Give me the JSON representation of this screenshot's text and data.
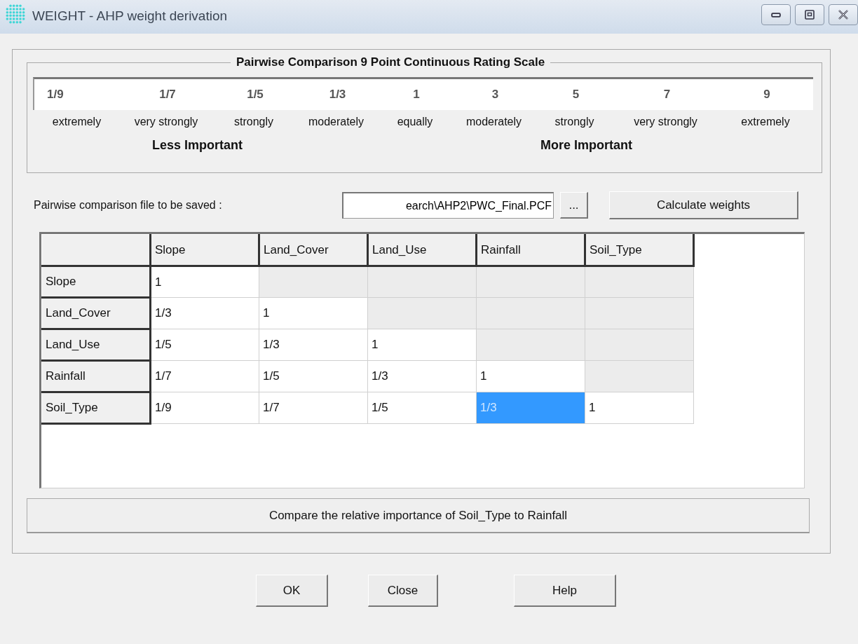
{
  "window": {
    "title": "WEIGHT - AHP weight derivation",
    "controls": [
      {
        "kind": "minimize"
      },
      {
        "kind": "maximize"
      },
      {
        "kind": "close"
      }
    ]
  },
  "scale": {
    "title": "Pairwise Comparison 9 Point Continuous Rating Scale",
    "points": [
      {
        "value": "1/9",
        "label": "extremely"
      },
      {
        "value": "1/7",
        "label": "very strongly"
      },
      {
        "value": "1/5",
        "label": "strongly"
      },
      {
        "value": "1/3",
        "label": "moderately"
      },
      {
        "value": "1",
        "label": "equally"
      },
      {
        "value": "3",
        "label": "moderately"
      },
      {
        "value": "5",
        "label": "strongly"
      },
      {
        "value": "7",
        "label": "very strongly"
      },
      {
        "value": "9",
        "label": "extremely"
      }
    ],
    "less_label": "Less Important",
    "more_label": "More Important"
  },
  "file": {
    "label": "Pairwise comparison file to be saved :",
    "value": "earch\\AHP2\\PWC_Final.PCF",
    "browse_button": "...",
    "calculate_button": "Calculate weights"
  },
  "grid": {
    "columns": [
      "Slope",
      "Land_Cover",
      "Land_Use",
      "Rainfall",
      "Soil_Type"
    ],
    "rows": [
      {
        "header": "Slope",
        "cells": [
          {
            "text": "1",
            "editable": true,
            "selected": false
          },
          {
            "editable": false,
            "selected": false
          },
          {
            "editable": false,
            "selected": false
          },
          {
            "editable": false,
            "selected": false
          },
          {
            "editable": false,
            "selected": false
          }
        ]
      },
      {
        "header": "Land_Cover",
        "cells": [
          {
            "text": "1/3",
            "editable": true,
            "selected": false
          },
          {
            "text": "1",
            "editable": true,
            "selected": false
          },
          {
            "editable": false,
            "selected": false
          },
          {
            "editable": false,
            "selected": false
          },
          {
            "editable": false,
            "selected": false
          }
        ]
      },
      {
        "header": "Land_Use",
        "cells": [
          {
            "text": "1/5",
            "editable": true,
            "selected": false
          },
          {
            "text": "1/3",
            "editable": true,
            "selected": false
          },
          {
            "text": "1",
            "editable": true,
            "selected": false
          },
          {
            "editable": false,
            "selected": false
          },
          {
            "editable": false,
            "selected": false
          }
        ]
      },
      {
        "header": "Rainfall",
        "cells": [
          {
            "text": "1/7",
            "editable": true,
            "selected": false
          },
          {
            "text": "1/5",
            "editable": true,
            "selected": false
          },
          {
            "text": "1/3",
            "editable": true,
            "selected": false
          },
          {
            "text": "1",
            "editable": true,
            "selected": false
          },
          {
            "editable": false,
            "selected": false
          }
        ]
      },
      {
        "header": "Soil_Type",
        "cells": [
          {
            "text": "1/9",
            "editable": true,
            "selected": false
          },
          {
            "text": "1/7",
            "editable": true,
            "selected": false
          },
          {
            "text": "1/5",
            "editable": true,
            "selected": false
          },
          {
            "text": "1/3",
            "editable": true,
            "selected": true
          },
          {
            "text": "1",
            "editable": true,
            "selected": false
          }
        ]
      }
    ]
  },
  "status": "Compare the relative importance of Soil_Type to Rainfall",
  "buttons": [
    "OK",
    "Close",
    "Help"
  ]
}
